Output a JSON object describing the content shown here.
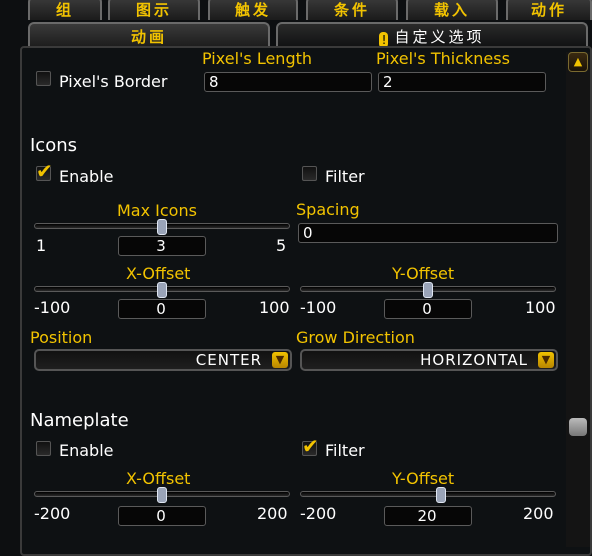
{
  "tabs_row1": [
    {
      "label": "组"
    },
    {
      "label": "图示"
    },
    {
      "label": "触发"
    },
    {
      "label": "条件"
    },
    {
      "label": "载入"
    },
    {
      "label": "动作"
    }
  ],
  "tabs_row2": [
    {
      "label": "动画"
    },
    {
      "label": "自定义选项",
      "active": true
    }
  ],
  "border": {
    "checkbox_label": "Pixel's Border",
    "checked": false,
    "length_label": "Pixel's Length",
    "length_value": "8",
    "thickness_label": "Pixel's Thickness",
    "thickness_value": "2"
  },
  "icons": {
    "title": "Icons",
    "enable_label": "Enable",
    "enable_checked": true,
    "filter_label": "Filter",
    "filter_checked": false,
    "max_icons": {
      "label": "Max Icons",
      "min": "1",
      "max": "5",
      "value": "3",
      "fraction": 0.5
    },
    "spacing": {
      "label": "Spacing",
      "value": "0"
    },
    "x_offset": {
      "label": "X-Offset",
      "min": "-100",
      "max": "100",
      "value": "0",
      "fraction": 0.5
    },
    "y_offset": {
      "label": "Y-Offset",
      "min": "-100",
      "max": "100",
      "value": "0",
      "fraction": 0.5
    },
    "position": {
      "label": "Position",
      "value": "CENTER"
    },
    "grow_direction": {
      "label": "Grow Direction",
      "value": "HORIZONTAL"
    }
  },
  "nameplate": {
    "title": "Nameplate",
    "enable_label": "Enable",
    "enable_checked": false,
    "filter_label": "Filter",
    "filter_checked": true,
    "x_offset": {
      "label": "X-Offset",
      "min": "-200",
      "max": "200",
      "value": "0",
      "fraction": 0.5
    },
    "y_offset": {
      "label": "Y-Offset",
      "min": "-200",
      "max": "200",
      "value": "20",
      "fraction": 0.55
    }
  },
  "icon_names": {
    "warning": "exclamation-icon",
    "scroll_up": "arrow-up-icon",
    "dropdown": "chevron-down-icon",
    "check": "checkmark-icon"
  },
  "colors": {
    "label_gold": "#f2c300",
    "background": "#0e1113",
    "text": "#ffffff"
  }
}
